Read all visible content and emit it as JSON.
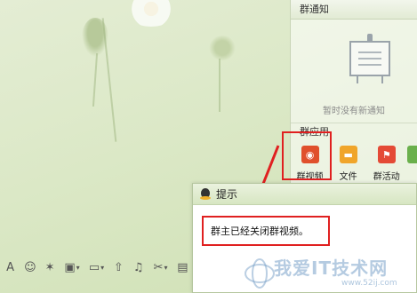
{
  "toolbar": {
    "icons": [
      "font-icon",
      "emoji-icon",
      "magic-icon",
      "image-icon",
      "screenshot-icon",
      "upload-icon",
      "music-icon",
      "scissors-icon",
      "message-icon"
    ]
  },
  "sidebar": {
    "notice_title": "群通知",
    "notice_empty": "暂时没有新通知",
    "apps_title": "群应用",
    "apps": [
      {
        "label": "群视频",
        "icon": "group-video-icon"
      },
      {
        "label": "文件",
        "icon": "folder-icon"
      },
      {
        "label": "群活动",
        "icon": "flag-icon"
      }
    ]
  },
  "dialog": {
    "title": "提示",
    "message": "群主已经关闭群视频。"
  },
  "watermark": {
    "text": "我爱IT技术网",
    "url": "www.52ij.com"
  },
  "colors": {
    "highlight": "#e02020",
    "background": "#dbe8c6"
  }
}
